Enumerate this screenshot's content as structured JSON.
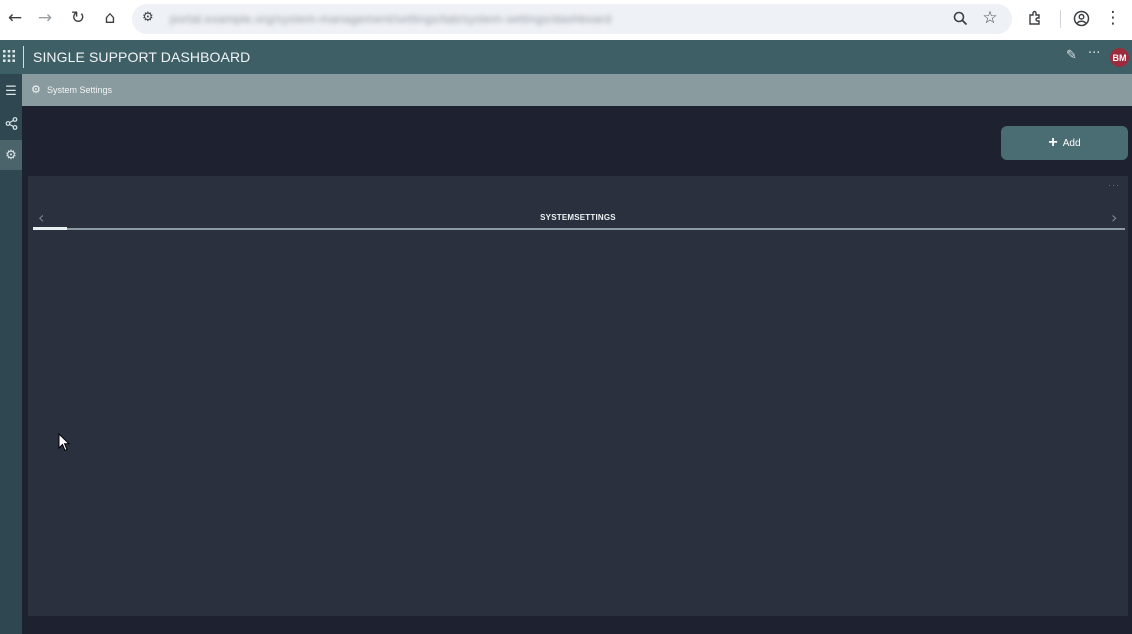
{
  "browser": {
    "url": "portal.example.org/system-management/settings/tab/system-settings/dashboard",
    "icons": [
      "back-icon",
      "forward-icon",
      "reload-icon",
      "home-icon",
      "site-settings-icon",
      "zoom-icon",
      "bookmark-star-icon",
      "extensions-icon",
      "profile-icon",
      "more-icon"
    ]
  },
  "header": {
    "title": "SINGLE SUPPORT DASHBOARD",
    "avatar_initials": "BM",
    "avatar_color": "#9c2b3d",
    "color": "#3e5f66"
  },
  "sidebar": {
    "items": [
      {
        "icon": "menu-icon"
      },
      {
        "icon": "share-nodes-icon"
      },
      {
        "icon": "gear-icon",
        "active": true
      }
    ]
  },
  "breadcrumb": {
    "label": "System Settings",
    "icon": "gear-icon"
  },
  "main": {
    "add_label": "Add",
    "tab_label": "SYSTEMSETTINGS"
  }
}
